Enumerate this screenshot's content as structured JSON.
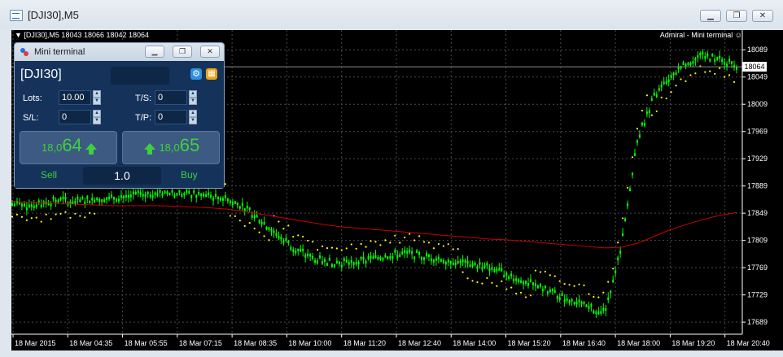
{
  "window": {
    "title": "[DJI30],M5",
    "buttons": [
      "minimize",
      "restore",
      "close"
    ]
  },
  "chart": {
    "header": "[DJI30],M5  18043 18066 18042 18064",
    "brand": "Admiral - Mini terminal",
    "current_price_tag": "18064",
    "colors": {
      "background": "#000000",
      "candles": "#00ff00",
      "ma": "#cc0000",
      "sar": "#ffff00",
      "grid": "#4a4a4a"
    }
  },
  "chart_data": {
    "type": "line",
    "title": "",
    "price_ticks": [
      "18089",
      "18049",
      "18009",
      "17969",
      "17929",
      "17889",
      "17849",
      "17809",
      "17769",
      "17729",
      "17689"
    ],
    "time_ticks": [
      "18 Mar 2015",
      "18 Mar 04:35",
      "18 Mar 05:55",
      "18 Mar 07:15",
      "18 Mar 08:35",
      "18 Mar 10:00",
      "18 Mar 11:20",
      "18 Mar 12:40",
      "18 Mar 14:00",
      "18 Mar 15:20",
      "18 Mar 16:40",
      "18 Mar 18:00",
      "18 Mar 19:20",
      "18 Mar 20:40"
    ],
    "ylim": [
      17676,
      18106
    ],
    "series": [
      {
        "values": [
          17862,
          17860,
          17865,
          17868,
          17866,
          17870,
          17872,
          17874,
          17876,
          17880,
          17878,
          17876,
          17874,
          17870,
          17860,
          17840,
          17820,
          17800,
          17785,
          17778,
          17776,
          17778,
          17782,
          17788,
          17790,
          17786,
          17782,
          17778,
          17774,
          17770,
          17760,
          17750,
          17740,
          17730,
          17720,
          17710,
          17705,
          17800,
          17960,
          18020,
          18050,
          18070,
          18080,
          18075,
          18064
        ]
      },
      {
        "values": [
          17866,
          17865,
          17864,
          17863,
          17862,
          17861,
          17860,
          17860,
          17860,
          17860,
          17859,
          17858,
          17857,
          17855,
          17852,
          17848,
          17844,
          17840,
          17836,
          17832,
          17829,
          17827,
          17825,
          17823,
          17821,
          17819,
          17817,
          17815,
          17813,
          17811,
          17810,
          17808,
          17806,
          17804,
          17802,
          17800,
          17798,
          17799,
          17805,
          17815,
          17825,
          17833,
          17840,
          17846,
          17850
        ]
      }
    ]
  },
  "mini_terminal": {
    "title": "Mini terminal",
    "symbol": "[DJI30]",
    "lots_label": "Lots:",
    "lots_value": "10.00",
    "sl_label": "S/L:",
    "sl_value": "0",
    "ts_label": "T/S:",
    "ts_value": "0",
    "tp_label": "T/P:",
    "tp_value": "0",
    "sell_prefix": "18,0",
    "sell_big": "64",
    "buy_prefix": "18,0",
    "buy_big": "65",
    "sell_label": "Sell",
    "buy_label": "Buy",
    "volume": "1.0"
  }
}
